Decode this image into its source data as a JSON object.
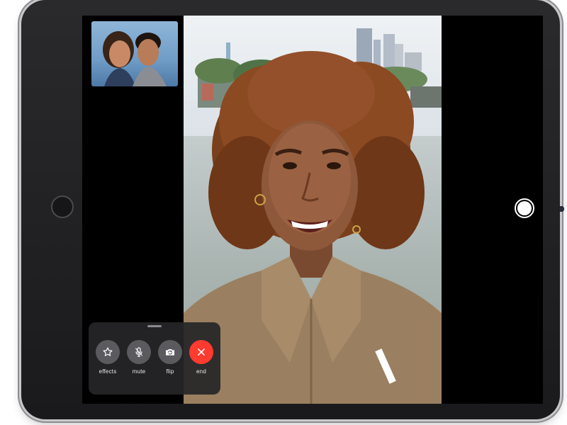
{
  "call": {
    "controls": [
      {
        "id": "effects",
        "label": "effects",
        "icon": "star-effects-icon"
      },
      {
        "id": "mute",
        "label": "mute",
        "icon": "microphone-icon"
      },
      {
        "id": "flip",
        "label": "flip",
        "icon": "camera-flip-icon"
      },
      {
        "id": "end",
        "label": "end",
        "icon": "close-icon"
      }
    ]
  },
  "colors": {
    "end_button": "#ff3b30",
    "control_button": "#5b5b5f",
    "panel": "#262628",
    "screen": "#000000"
  }
}
